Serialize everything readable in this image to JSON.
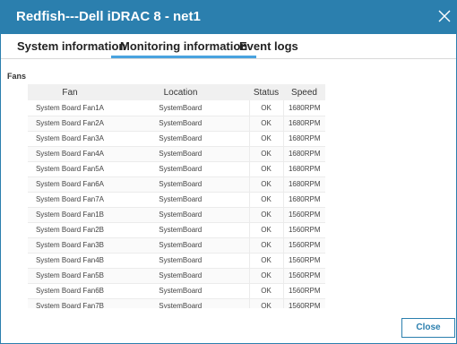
{
  "dialog": {
    "title": "Redfish---Dell iDRAC 8 - net1",
    "close_icon": "close-icon"
  },
  "tabs": [
    {
      "label": "System information",
      "active": false
    },
    {
      "label": "Monitoring information",
      "active": true
    },
    {
      "label": "Event logs",
      "active": false
    }
  ],
  "section": {
    "label": "Fans"
  },
  "table": {
    "columns": [
      "Fan",
      "Location",
      "Status",
      "Speed"
    ],
    "rows": [
      [
        "System Board Fan1A",
        "SystemBoard",
        "OK",
        "1680RPM"
      ],
      [
        "System Board Fan2A",
        "SystemBoard",
        "OK",
        "1680RPM"
      ],
      [
        "System Board Fan3A",
        "SystemBoard",
        "OK",
        "1680RPM"
      ],
      [
        "System Board Fan4A",
        "SystemBoard",
        "OK",
        "1680RPM"
      ],
      [
        "System Board Fan5A",
        "SystemBoard",
        "OK",
        "1680RPM"
      ],
      [
        "System Board Fan6A",
        "SystemBoard",
        "OK",
        "1680RPM"
      ],
      [
        "System Board Fan7A",
        "SystemBoard",
        "OK",
        "1680RPM"
      ],
      [
        "System Board Fan1B",
        "SystemBoard",
        "OK",
        "1560RPM"
      ],
      [
        "System Board Fan2B",
        "SystemBoard",
        "OK",
        "1560RPM"
      ],
      [
        "System Board Fan3B",
        "SystemBoard",
        "OK",
        "1560RPM"
      ],
      [
        "System Board Fan4B",
        "SystemBoard",
        "OK",
        "1560RPM"
      ],
      [
        "System Board Fan5B",
        "SystemBoard",
        "OK",
        "1560RPM"
      ],
      [
        "System Board Fan6B",
        "SystemBoard",
        "OK",
        "1560RPM"
      ],
      [
        "System Board Fan7B",
        "SystemBoard",
        "OK",
        "1560RPM"
      ]
    ]
  },
  "footer": {
    "close_label": "Close"
  },
  "colors": {
    "accent": "#2b7fae",
    "tab_underline": "#4aa3df"
  }
}
